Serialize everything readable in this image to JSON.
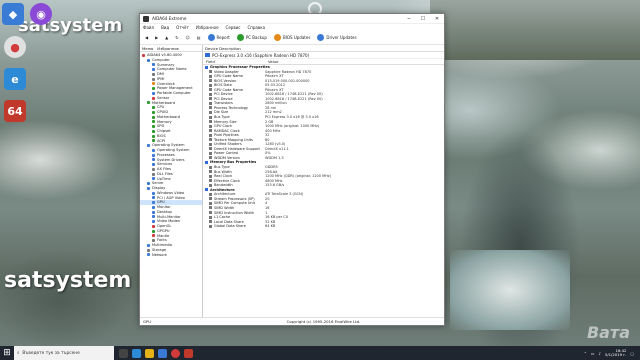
{
  "desktop": {
    "brand_top": "satsystem",
    "brand_bottom": "satsystem",
    "watermark": "Вата"
  },
  "window": {
    "title": "AIDA64 Extreme",
    "menu": [
      "Файл",
      "Вид",
      "Отчёт",
      "Избранное",
      "Сервис",
      "Справка"
    ],
    "toolbar": [
      "Report",
      "PC Backup",
      "BIOS Updates",
      "Driver Updates"
    ],
    "left_tabs": [
      "Меню",
      "Избранное"
    ],
    "crumb": "Device Description",
    "device_title": "PCI-Express 3.0 x16 (Sapphire Radeon HD 7870)",
    "col_field": "Field",
    "col_value": "Value",
    "tree": [
      {
        "label": "AIDA64 v5.80.4000",
        "color": "#d23b3b",
        "indent": 0
      },
      {
        "label": "Computer",
        "color": "#3a78d6",
        "indent": 1
      },
      {
        "label": "Summary",
        "color": "#3a78d6",
        "indent": 2
      },
      {
        "label": "Computer Name",
        "color": "#3a78d6",
        "indent": 2
      },
      {
        "label": "DMI",
        "color": "#777777",
        "indent": 2
      },
      {
        "label": "IPMI",
        "color": "#777777",
        "indent": 2
      },
      {
        "label": "Overclock",
        "color": "#e58a18",
        "indent": 2
      },
      {
        "label": "Power Management",
        "color": "#2c9b2c",
        "indent": 2
      },
      {
        "label": "Portable Computer",
        "color": "#3a78d6",
        "indent": 2
      },
      {
        "label": "Sensor",
        "color": "#d23b3b",
        "indent": 2
      },
      {
        "label": "Motherboard",
        "color": "#2c9b2c",
        "indent": 1
      },
      {
        "label": "CPU",
        "color": "#2c9b2c",
        "indent": 2
      },
      {
        "label": "CPUID",
        "color": "#2c9b2c",
        "indent": 2
      },
      {
        "label": "Motherboard",
        "color": "#2c9b2c",
        "indent": 2
      },
      {
        "label": "Memory",
        "color": "#2c9b2c",
        "indent": 2
      },
      {
        "label": "SPD",
        "color": "#2c9b2c",
        "indent": 2
      },
      {
        "label": "Chipset",
        "color": "#2c9b2c",
        "indent": 2
      },
      {
        "label": "BIOS",
        "color": "#2c9b2c",
        "indent": 2
      },
      {
        "label": "ACPI",
        "color": "#2c9b2c",
        "indent": 2
      },
      {
        "label": "Operating System",
        "color": "#3a78d6",
        "indent": 1
      },
      {
        "label": "Operating System",
        "color": "#3a78d6",
        "indent": 2
      },
      {
        "label": "Processes",
        "color": "#3a78d6",
        "indent": 2
      },
      {
        "label": "System Drivers",
        "color": "#3a78d6",
        "indent": 2
      },
      {
        "label": "Services",
        "color": "#3a78d6",
        "indent": 2
      },
      {
        "label": "AX Files",
        "color": "#777777",
        "indent": 2
      },
      {
        "label": "DLL Files",
        "color": "#777777",
        "indent": 2
      },
      {
        "label": "UpTime",
        "color": "#3a78d6",
        "indent": 2
      },
      {
        "label": "Server",
        "color": "#3a78d6",
        "indent": 1
      },
      {
        "label": "Display",
        "color": "#3a78d6",
        "indent": 1
      },
      {
        "label": "Windows Video",
        "color": "#3a78d6",
        "indent": 2
      },
      {
        "label": "PCI / AGP Video",
        "color": "#3a78d6",
        "indent": 2
      },
      {
        "label": "GPU",
        "color": "#3a78d6",
        "indent": 2,
        "selected": true
      },
      {
        "label": "Monitor",
        "color": "#3a78d6",
        "indent": 2
      },
      {
        "label": "Desktop",
        "color": "#3a78d6",
        "indent": 2
      },
      {
        "label": "Multi-Monitor",
        "color": "#3a78d6",
        "indent": 2
      },
      {
        "label": "Video Modes",
        "color": "#3a78d6",
        "indent": 2
      },
      {
        "label": "OpenGL",
        "color": "#d23b3b",
        "indent": 2
      },
      {
        "label": "GPGPU",
        "color": "#2c9b2c",
        "indent": 2
      },
      {
        "label": "Mantle",
        "color": "#d23b3b",
        "indent": 2
      },
      {
        "label": "Fonts",
        "color": "#777777",
        "indent": 2
      },
      {
        "label": "Multimedia",
        "color": "#3a78d6",
        "indent": 1
      },
      {
        "label": "Storage",
        "color": "#777777",
        "indent": 1
      },
      {
        "label": "Network",
        "color": "#3a78d6",
        "indent": 1
      }
    ],
    "rows": [
      {
        "sec": true,
        "f": "Graphics Processor Properties",
        "v": ""
      },
      {
        "f": "Video Adapter",
        "v": "Sapphire Radeon HD 7870"
      },
      {
        "f": "GPU Code Name",
        "v": "Pitcairn XT"
      },
      {
        "f": "BIOS Version",
        "v": "015.019.000.001.000000"
      },
      {
        "f": "BIOS Date",
        "v": "05.03.2012"
      },
      {
        "f": "GPU Code Name",
        "v": "Pitcairn XT"
      },
      {
        "f": "PCI Device",
        "v": "1002-6818 / 174B-E221 (Rev 00)"
      },
      {
        "f": "PCI Device",
        "v": "1002-6818 / 174B-E221 (Rev 00)"
      },
      {
        "f": "Transistors",
        "v": "2800 million"
      },
      {
        "f": "Process Technology",
        "v": "28 nm"
      },
      {
        "f": "Die Size",
        "v": "212 mm2"
      },
      {
        "f": "Bus Type",
        "v": "PCI Express 3.0 x16 @ 3.0 x16"
      },
      {
        "f": "Memory Size",
        "v": "2 GB"
      },
      {
        "f": "GPU Clock",
        "v": "1000 MHz (original: 1000 MHz)"
      },
      {
        "f": "RAMDAC Clock",
        "v": "400 MHz"
      },
      {
        "f": "Pixel Pipelines",
        "v": "32"
      },
      {
        "f": "Texture Mapping Units",
        "v": "80"
      },
      {
        "f": "Unified Shaders",
        "v": "1280 (v5.0)"
      },
      {
        "f": "DirectX Hardware Support",
        "v": "DirectX v11.1"
      },
      {
        "f": "Power Control",
        "v": "0%"
      },
      {
        "f": "WDDM Version",
        "v": "WDDM 1.3"
      },
      {
        "sec": true,
        "f": "Memory Bus Properties",
        "v": ""
      },
      {
        "f": "Bus Type",
        "v": "GDDR5"
      },
      {
        "f": "Bus Width",
        "v": "256-bit"
      },
      {
        "f": "Real Clock",
        "v": "1200 MHz (QDR) (original: 1200 MHz)"
      },
      {
        "f": "Effective Clock",
        "v": "4800 MHz"
      },
      {
        "f": "Bandwidth",
        "v": "153.6 GB/s"
      },
      {
        "sec": true,
        "f": "Architecture",
        "v": ""
      },
      {
        "f": "Architecture",
        "v": "ATI TeraScale 3 (GCN)"
      },
      {
        "f": "Stream Processors (SP)",
        "v": "20"
      },
      {
        "f": "SIMD Per Compute Unit",
        "v": "4"
      },
      {
        "f": "SIMD Width",
        "v": "16"
      },
      {
        "f": "SIMD Instruction Width",
        "v": "1"
      },
      {
        "f": "L1 Cache",
        "v": "16 KB per CU"
      },
      {
        "f": "Local Data Share",
        "v": "32 KB"
      },
      {
        "f": "Global Data Share",
        "v": "64 KB"
      }
    ],
    "status_left": "GPU",
    "status_center": "Copyright (c) 1995-2016 FinalWire Ltd."
  },
  "taskbar": {
    "search_placeholder": "Въведете тук за търсене",
    "time": "16:42",
    "date": "5/1/2019 г."
  }
}
